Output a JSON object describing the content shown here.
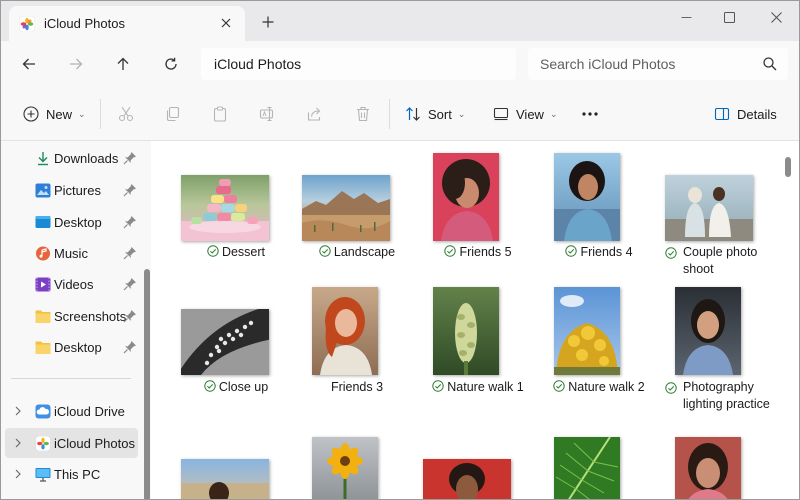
{
  "window": {
    "tab_title": "iCloud Photos",
    "tab_icon": "photos-app-icon"
  },
  "address": {
    "path": "iCloud Photos",
    "search_placeholder": "Search iCloud Photos"
  },
  "commands": {
    "new": "New",
    "sort": "Sort",
    "view": "View",
    "details": "Details"
  },
  "sidebar": {
    "quick_access": [
      {
        "label": "Downloads",
        "icon": "download-icon",
        "pinned": true
      },
      {
        "label": "Pictures",
        "icon": "pictures-folder-icon",
        "pinned": true
      },
      {
        "label": "Desktop",
        "icon": "desktop-folder-icon",
        "pinned": true
      },
      {
        "label": "Music",
        "icon": "music-folder-icon",
        "pinned": true
      },
      {
        "label": "Videos",
        "icon": "videos-folder-icon",
        "pinned": true
      },
      {
        "label": "Screenshots",
        "icon": "folder-icon",
        "pinned": true
      },
      {
        "label": "Desktop",
        "icon": "folder-icon",
        "pinned": true
      }
    ],
    "locations": [
      {
        "label": "iCloud Drive",
        "icon": "icloud-drive-icon",
        "selected": false
      },
      {
        "label": "iCloud Photos",
        "icon": "photos-app-icon",
        "selected": true
      },
      {
        "label": "This PC",
        "icon": "this-pc-icon",
        "selected": false
      }
    ]
  },
  "files": [
    {
      "name": "Dessert",
      "synced": true
    },
    {
      "name": "Landscape",
      "synced": true
    },
    {
      "name": "Friends 5",
      "synced": true
    },
    {
      "name": "Friends 4",
      "synced": true
    },
    {
      "name": "Couple photo shoot",
      "synced": true
    },
    {
      "name": "Close up",
      "synced": true
    },
    {
      "name": "Friends 3",
      "synced": false
    },
    {
      "name": "Nature walk 1",
      "synced": true
    },
    {
      "name": "Nature walk 2",
      "synced": true
    },
    {
      "name": "Photography lighting practice",
      "synced": true
    },
    {
      "name": "",
      "synced": false
    },
    {
      "name": "",
      "synced": false
    },
    {
      "name": "",
      "synced": false
    },
    {
      "name": "",
      "synced": false
    },
    {
      "name": "",
      "synced": false
    }
  ],
  "colors": {
    "accent": "#0067c0",
    "sync_green": "#2e7d32",
    "folder_yellow": "#f3c13a"
  }
}
